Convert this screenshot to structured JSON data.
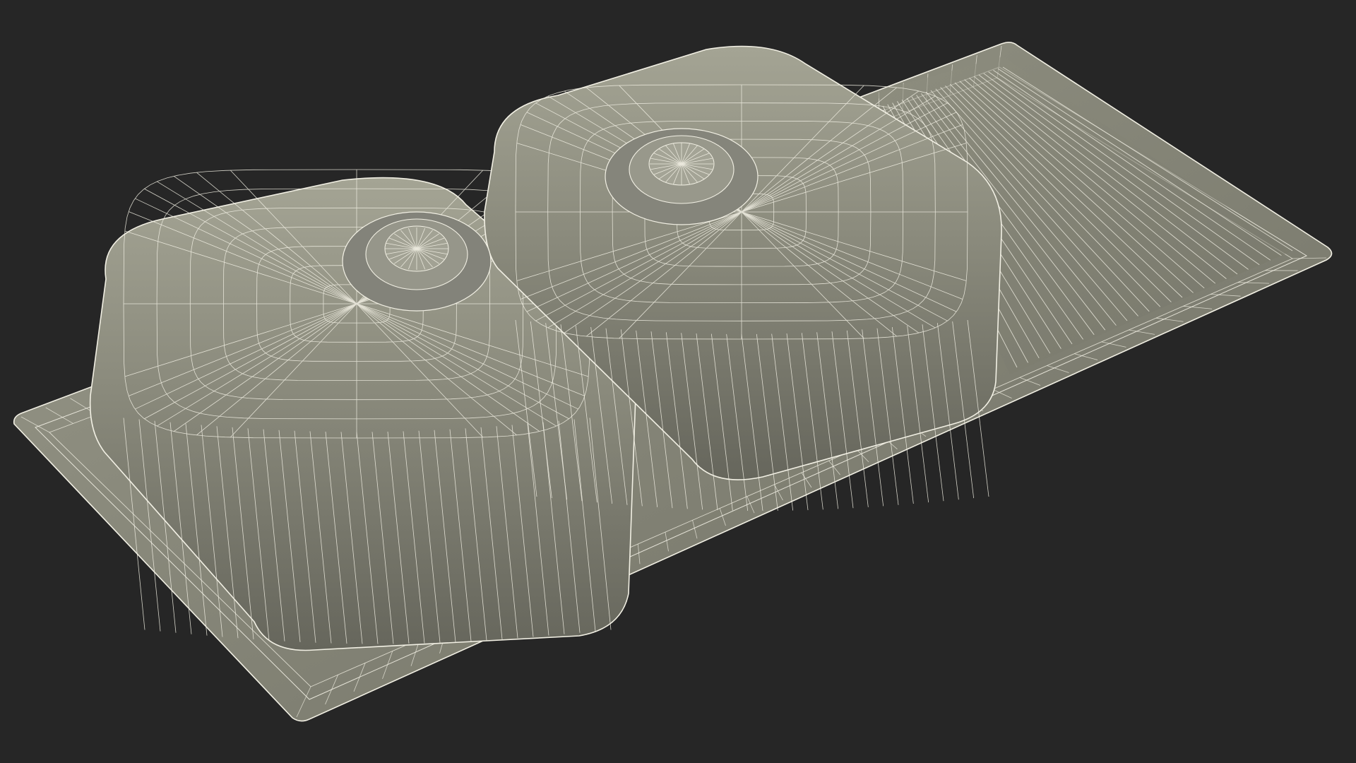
{
  "viewport": {
    "background": "#262626"
  },
  "model": {
    "subject": "double-bowl-sink-with-drainboard",
    "render_mode": "wireframe-over-shaded",
    "surface_color": "#7f7f72",
    "surface_light": "#a7a797",
    "surface_dark": "#5f5f55",
    "wire_color": "#f2f0e4",
    "parts": [
      "rim-flange",
      "left-basin",
      "right-basin",
      "left-drain",
      "right-drain",
      "drainboard"
    ]
  }
}
